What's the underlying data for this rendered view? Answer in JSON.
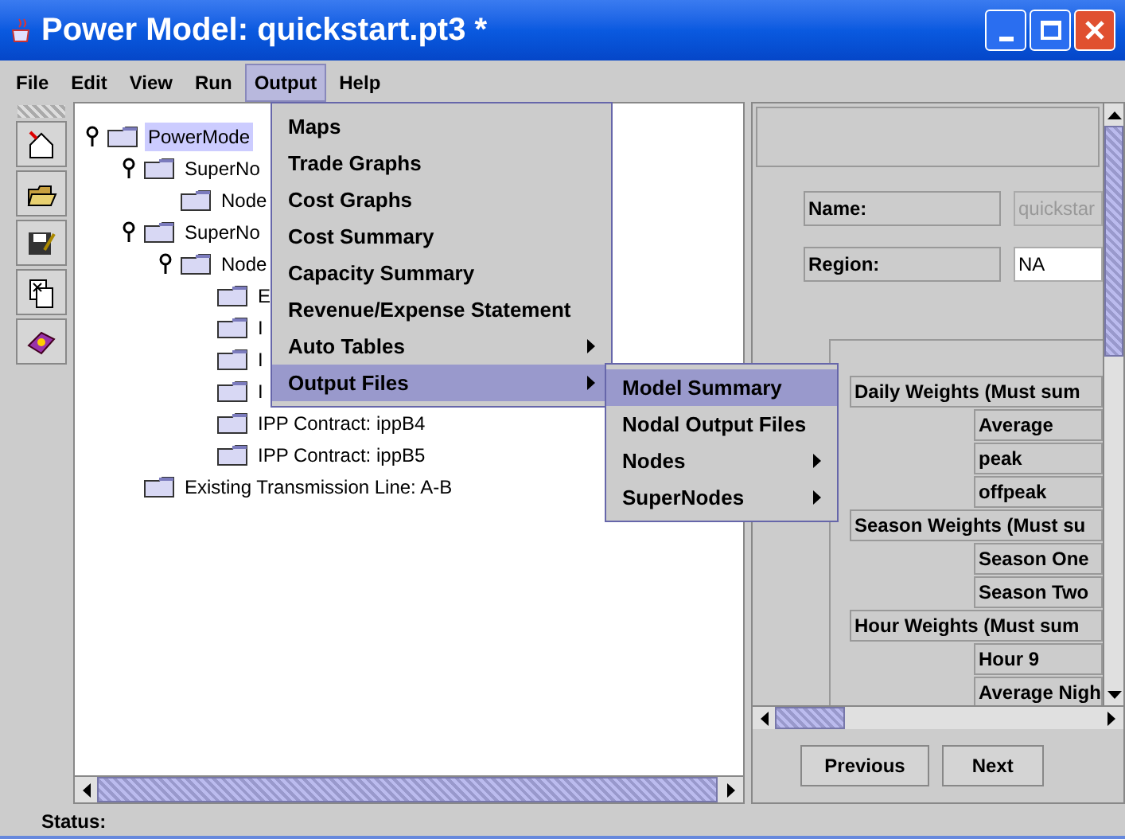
{
  "window": {
    "title": "Power Model: quickstart.pt3 *"
  },
  "menu_bar": [
    {
      "label": "File",
      "selected": false
    },
    {
      "label": "Edit",
      "selected": false
    },
    {
      "label": "View",
      "selected": false
    },
    {
      "label": "Run",
      "selected": false
    },
    {
      "label": "Output",
      "selected": true
    },
    {
      "label": "Help",
      "selected": false
    }
  ],
  "tree": [
    {
      "label": "PowerMode",
      "selected": true,
      "expanded": true,
      "children": [
        {
          "label": "SuperNo",
          "selected": false,
          "expanded": true,
          "children": [
            {
              "label": "Node",
              "selected": false
            }
          ]
        },
        {
          "label": "SuperNo",
          "selected": false,
          "expanded": true,
          "children": [
            {
              "label": "Node",
              "selected": false,
              "expanded": true,
              "children": [
                {
                  "label": "E",
                  "selected": false
                },
                {
                  "label": "I",
                  "selected": false
                },
                {
                  "label": "I",
                  "selected": false
                },
                {
                  "label": "I",
                  "selected": false
                },
                {
                  "label": "IPP Contract: ippB4",
                  "selected": false
                },
                {
                  "label": "IPP Contract: ippB5",
                  "selected": false
                }
              ]
            }
          ]
        },
        {
          "label": "Existing Transmission Line: A-B",
          "selected": false
        }
      ]
    }
  ],
  "output_menu": [
    {
      "label": "Maps",
      "submenu": false,
      "selected": false
    },
    {
      "label": "Trade Graphs",
      "submenu": false,
      "selected": false
    },
    {
      "label": "Cost Graphs",
      "submenu": false,
      "selected": false
    },
    {
      "label": "Cost Summary",
      "submenu": false,
      "selected": false
    },
    {
      "label": "Capacity Summary",
      "submenu": false,
      "selected": false
    },
    {
      "label": "Revenue/Expense Statement",
      "submenu": false,
      "selected": false
    },
    {
      "label": "Auto Tables",
      "submenu": true,
      "selected": false
    },
    {
      "label": "Output Files",
      "submenu": true,
      "selected": true
    }
  ],
  "output_files_submenu": [
    {
      "label": "Model Summary",
      "submenu": false,
      "selected": true
    },
    {
      "label": "Nodal Output Files",
      "submenu": false,
      "selected": false
    },
    {
      "label": "Nodes",
      "submenu": true,
      "selected": false
    },
    {
      "label": "SuperNodes",
      "submenu": true,
      "selected": false
    }
  ],
  "properties": {
    "name_label": "Name:",
    "name_value": "quickstar",
    "name_disabled": true,
    "region_label": "Region:",
    "region_value": "NA",
    "region_disabled": false
  },
  "weights": [
    {
      "kind": "header",
      "label": "Daily Weights (Must sum"
    },
    {
      "kind": "item",
      "label": "Average"
    },
    {
      "kind": "item",
      "label": "peak"
    },
    {
      "kind": "item",
      "label": "offpeak"
    },
    {
      "kind": "header",
      "label": "Season Weights (Must su"
    },
    {
      "kind": "item",
      "label": "Season One"
    },
    {
      "kind": "item",
      "label": "Season Two"
    },
    {
      "kind": "header",
      "label": "Hour Weights (Must sum"
    },
    {
      "kind": "item",
      "label": "Hour 9"
    },
    {
      "kind": "item",
      "label": "Average Nigh"
    }
  ],
  "buttons": [
    "Previous",
    "Next"
  ],
  "status_bar": {
    "label": "Status:"
  }
}
